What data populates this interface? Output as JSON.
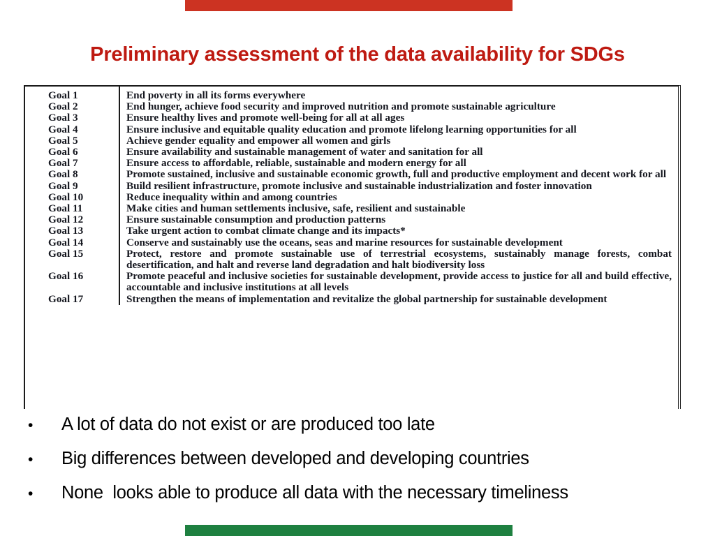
{
  "decor": {
    "top_bar_color": "#CC3322",
    "bottom_bar_color": "#1E8040"
  },
  "title": {
    "text": "Preliminary assessment of the data availability for SDGs",
    "color": "#BE1A11"
  },
  "goals_table": {
    "rows": [
      {
        "label": "Goal 1",
        "text": "End poverty in all its forms everywhere"
      },
      {
        "label": "Goal 2",
        "text": "End hunger, achieve food security and improved nutrition and promote sustainable agriculture"
      },
      {
        "label": "Goal 3",
        "text": "Ensure healthy lives and promote well-being for all at all ages"
      },
      {
        "label": "Goal 4",
        "text": "Ensure inclusive and equitable quality education and promote lifelong learning opportunities for all"
      },
      {
        "label": "Goal 5",
        "text": "Achieve gender equality and empower all women and girls"
      },
      {
        "label": "Goal 6",
        "text": "Ensure availability and sustainable management of water and sanitation for all"
      },
      {
        "label": "Goal 7",
        "text": "Ensure access to affordable, reliable, sustainable and modern energy for all"
      },
      {
        "label": "Goal 8",
        "text": "Promote sustained, inclusive and sustainable economic growth, full and productive employment and decent work for all"
      },
      {
        "label": "Goal 9",
        "text": "Build resilient infrastructure, promote inclusive and sustainable industrialization and foster innovation"
      },
      {
        "label": "Goal 10",
        "text": "Reduce inequality within and among countries"
      },
      {
        "label": "Goal 11",
        "text": "Make cities and human settlements inclusive, safe, resilient and sustainable"
      },
      {
        "label": "Goal 12",
        "text": "Ensure sustainable consumption and production patterns"
      },
      {
        "label": "Goal 13",
        "text": "Take urgent action to combat climate change and its impacts*"
      },
      {
        "label": "Goal 14",
        "text": "Conserve and sustainably use the oceans, seas and marine resources for sustainable development"
      },
      {
        "label": "Goal 15",
        "text": "Protect, restore and promote sustainable use of terrestrial ecosystems, sustainably manage forests, combat desertification, and halt and reverse land degradation and halt biodiversity loss"
      },
      {
        "label": "Goal 16",
        "text": "Promote peaceful and inclusive societies for sustainable development, provide access to justice for all and build effective, accountable and inclusive institutions at all levels"
      },
      {
        "label": "Goal 17",
        "text": "Strengthen the means of implementation and revitalize the global partnership for sustainable development"
      }
    ]
  },
  "bullets": {
    "marker": "•",
    "items": [
      "A lot of data do not exist or are produced too late",
      "Big differences between developed and developing countries",
      "None  looks able to produce all data with the necessary timeliness"
    ]
  }
}
